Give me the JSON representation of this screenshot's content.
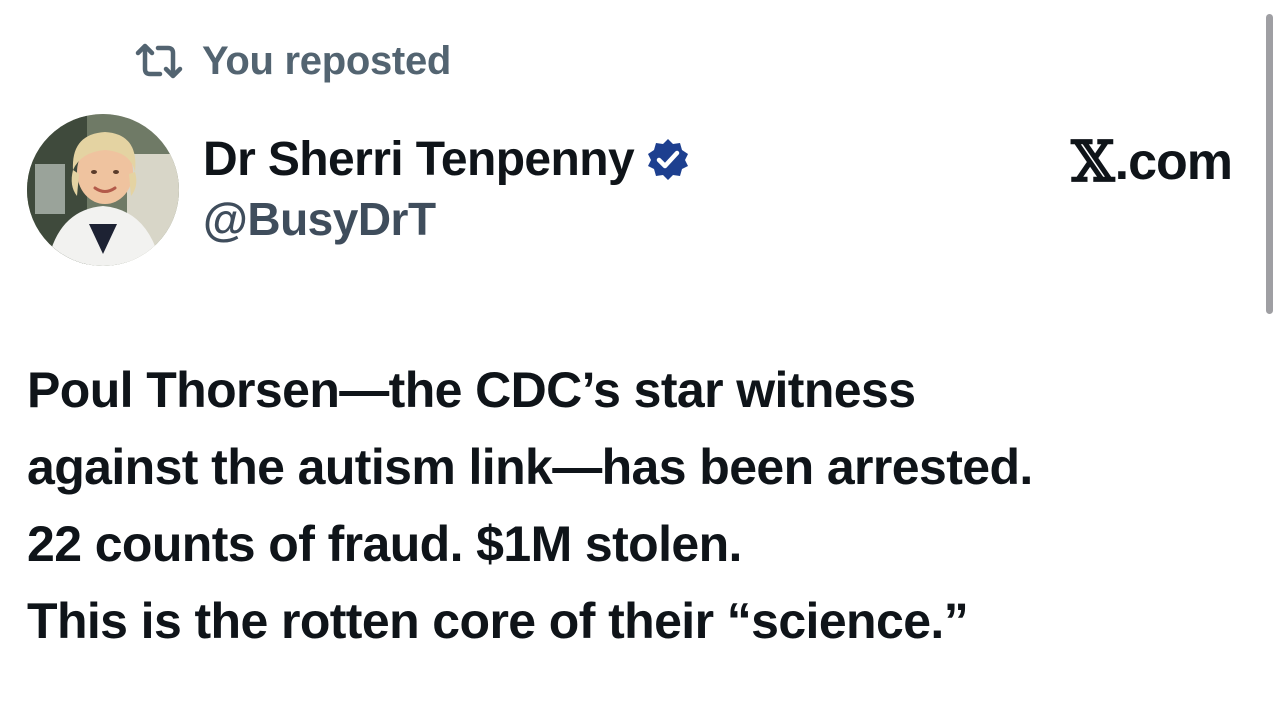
{
  "repost": {
    "icon": "repost-icon",
    "label": "You reposted"
  },
  "author": {
    "avatar": "profile-photo",
    "display_name": "Dr Sherri Tenpenny",
    "verified_icon": "verified-badge-icon",
    "handle": "@BusyDrT"
  },
  "site": {
    "x_glyph": "𝕏",
    "domain_suffix": ".com"
  },
  "post": {
    "lines": [
      "Poul Thorsen—the CDC’s star witness",
      "against the autism link—has been arrested.",
      "22 counts of fraud. $1M stolen.",
      "This is the rotten core of their “science.”"
    ]
  },
  "colors": {
    "text": "#0f1419",
    "secondary": "#536471",
    "verified": "#1d3f8f"
  }
}
